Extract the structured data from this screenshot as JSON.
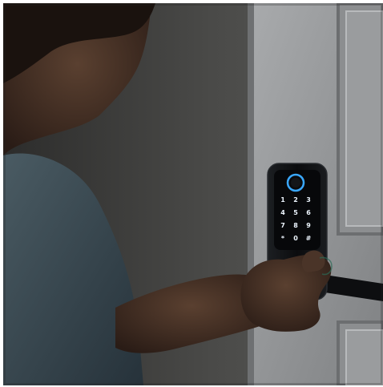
{
  "scene": {
    "subject": "smart-door-lock-demo",
    "lock": {
      "color": "#101214",
      "fingerprint_ring_color": "#3aa8ff",
      "keypad": [
        "1",
        "2",
        "3",
        "4",
        "5",
        "6",
        "7",
        "8",
        "9",
        "*",
        "0",
        "#"
      ]
    },
    "colors": {
      "wall": "#4a4a48",
      "door": "#9c9ea0",
      "door_panel": "#8a8c8e",
      "shirt": "#3b4a52",
      "skin": "#3a2a22"
    }
  }
}
